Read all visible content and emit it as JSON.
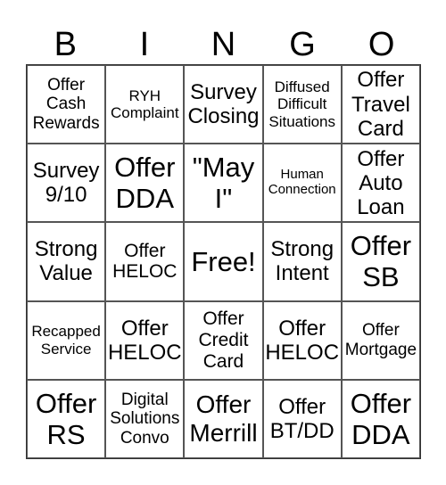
{
  "header": {
    "letters": [
      "B",
      "I",
      "N",
      "G",
      "O"
    ]
  },
  "cells": [
    "Offer\nCash\nRewards",
    "RYH\nComplaint",
    "Survey\nClosing",
    "Diffused\nDifficult\nSituations",
    "Offer\nTravel\nCard",
    "Survey\n9/10",
    "Offer\nDDA",
    "\"May\nI\"",
    "Human\nConnection",
    "Offer\nAuto\nLoan",
    "Strong\nValue",
    "Offer\nHELOC",
    "Free!",
    "Strong\nIntent",
    "Offer\nSB",
    "Recapped\nService",
    "Offer\nHELOC",
    "Offer\nCredit\nCard",
    "Offer\nHELOC",
    "Offer\nMortgage",
    "Offer\nRS",
    "Digital\nSolutions\nConvo",
    "Offer\nMerrill",
    "Offer\nBT/DD",
    "Offer\nDDA"
  ]
}
